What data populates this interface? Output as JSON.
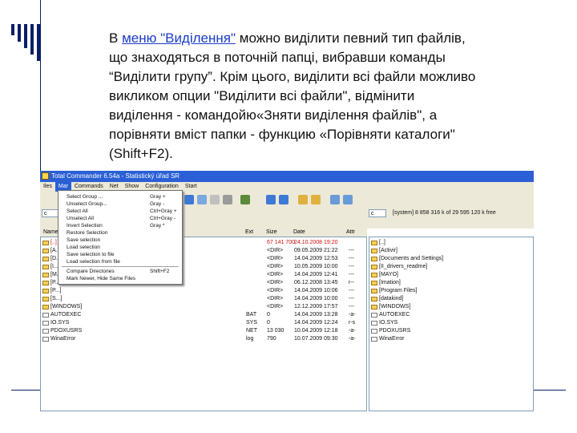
{
  "slide": {
    "line1_prefix": "В ",
    "line1_link": "меню \"Виділення\"",
    "line1_rest": "  можно виділити певний  тип файлів,",
    "line2": "що знаходяться в поточній папці, вибравши  команды",
    "line3": "“Виділити групу”. Крім цього, виділити всі файли можливо",
    "line4": "викликом опции \"Виділити всі файли\", відмінити",
    "line5": "виділення - командойю«Зняти виділення файлів\", а",
    "line6": "порівняти вміст папки - функцию «Порівняти каталоги\"",
    "line7": "(Shift+F2)."
  },
  "window": {
    "title": "Total Commander 6.54a - Statistický úřad SR",
    "menu": [
      "Iles",
      "Mar",
      "Commands",
      "Net",
      "Show",
      "Configuration",
      "Start"
    ],
    "left_drive": "c",
    "right_drive": "c",
    "right_drive_info": "[system]  8 858 316 k of 29 595 120 k free"
  },
  "selection_menu": {
    "items": [
      {
        "label": "Select Group ...",
        "shortcut": "Gray +"
      },
      {
        "label": "Unselect Group...",
        "shortcut": "Gray -"
      },
      {
        "label": "Select All",
        "shortcut": "Ctrl+Gray +"
      },
      {
        "label": "Unselect All",
        "shortcut": "Ctrl+Gray -"
      },
      {
        "label": "Invert Selection",
        "shortcut": "Gray *"
      },
      {
        "label": "Restore Selection",
        "shortcut": ""
      },
      {
        "label": "Save selection",
        "shortcut": ""
      },
      {
        "label": "Load selection",
        "shortcut": ""
      },
      {
        "label": "Save selection to file",
        "shortcut": ""
      },
      {
        "label": "Load selection from file",
        "shortcut": ""
      },
      {
        "label": "Compare Directories",
        "shortcut": "Shift+F2"
      },
      {
        "label": "Mark Newer, Hide Same Files",
        "shortcut": ""
      }
    ]
  },
  "left_panel": {
    "columns": [
      "Name",
      "Ext",
      "Size",
      "Date",
      "Attr"
    ],
    "rows": [
      {
        "name": "[..]",
        "ext": "",
        "size": "67 141 700",
        "date": "24.10.2008 19:20",
        "attr": "",
        "folder": true,
        "red": true
      },
      {
        "name": "[A...]",
        "ext": "",
        "size": "<DIR>",
        "date": "09.05.2009 21:22",
        "attr": "---",
        "folder": true
      },
      {
        "name": "[D...]",
        "ext": "",
        "size": "<DIR>",
        "date": "14.04.2009 12:53",
        "attr": "---",
        "folder": true
      },
      {
        "name": "[I...]",
        "ext": "",
        "size": "<DIR>",
        "date": "10.05.2009 10:00",
        "attr": "---",
        "folder": true
      },
      {
        "name": "[M...]",
        "ext": "",
        "size": "<DIR>",
        "date": "14.04.2009 12:41",
        "attr": "---",
        "folder": true
      },
      {
        "name": "[P...]",
        "ext": "",
        "size": "<DIR>",
        "date": "06.12.2008 13:45",
        "attr": "r--",
        "folder": true
      },
      {
        "name": "[P...]",
        "ext": "",
        "size": "<DIR>",
        "date": "14.04.2009 10:06",
        "attr": "---",
        "folder": true
      },
      {
        "name": "[S...]",
        "ext": "",
        "size": "<DIR>",
        "date": "14.04.2009 10:00",
        "attr": "---",
        "folder": true
      },
      {
        "name": "[WINDOWS]",
        "ext": "",
        "size": "<DIR>",
        "date": "12.12.2009 17:57",
        "attr": "---",
        "folder": true
      },
      {
        "name": "AUTOEXEC",
        "ext": "BAT",
        "size": "0",
        "date": "14.04.2009 13:28",
        "attr": "-a-",
        "folder": false
      },
      {
        "name": "IO.SYS",
        "ext": "SYS",
        "size": "0",
        "date": "14.04.2009 12:24",
        "attr": "r-s",
        "folder": false
      },
      {
        "name": "PDOXUSRS",
        "ext": "NET",
        "size": "13 030",
        "date": "10.04.2009 12:18",
        "attr": "-a-",
        "folder": false
      },
      {
        "name": "WinaError",
        "ext": "log",
        "size": "790",
        "date": "10.07.2009 09:30",
        "attr": "-a-",
        "folder": false
      }
    ]
  },
  "right_panel": {
    "rows": [
      {
        "name": "[..]",
        "folder": true
      },
      {
        "name": "[Activir]",
        "folder": true
      },
      {
        "name": "[Documents and Settings]",
        "folder": true
      },
      {
        "name": "[II_drivers_readme]",
        "folder": true
      },
      {
        "name": "[MAYO]",
        "folder": true
      },
      {
        "name": "[Imation]",
        "folder": true
      },
      {
        "name": "[Program Files]",
        "folder": true
      },
      {
        "name": "[datakind]",
        "folder": true
      },
      {
        "name": "[WINDOWS]",
        "folder": true
      },
      {
        "name": "AUTOEXEC",
        "folder": false
      },
      {
        "name": "IO.SYS",
        "folder": false
      },
      {
        "name": "PDOXUSRS",
        "folder": false
      },
      {
        "name": "WinaError",
        "folder": false
      }
    ]
  },
  "colors": {
    "accent": "#0b1f66",
    "link": "#1a3cc8",
    "titlebar": "#2a5fd6",
    "selected_row": "#d01010"
  }
}
